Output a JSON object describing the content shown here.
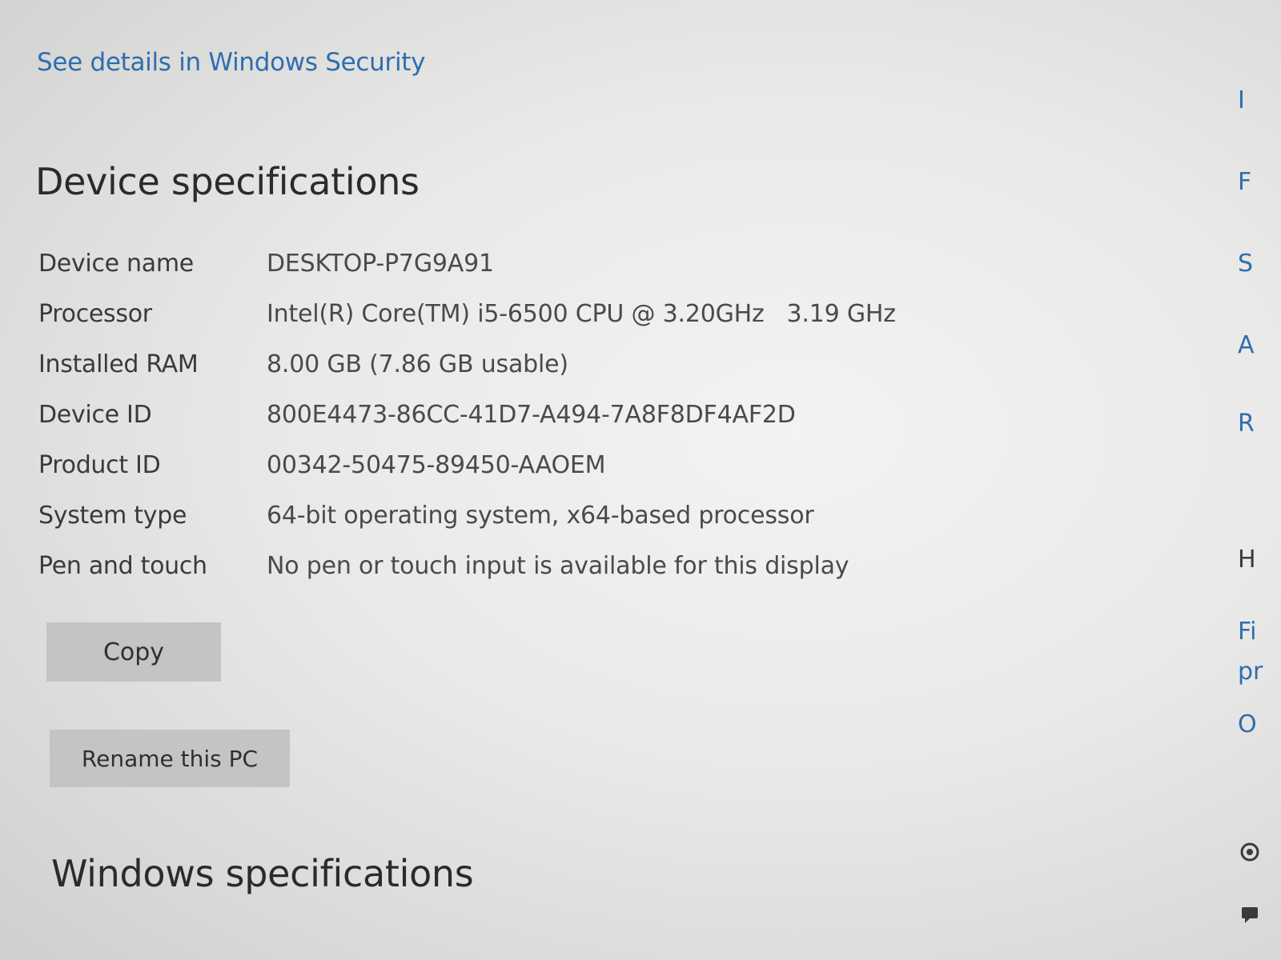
{
  "security_link": "See details in Windows Security",
  "device_section": {
    "title": "Device specifications",
    "specs": [
      {
        "label": "Device name",
        "value": "DESKTOP-P7G9A91"
      },
      {
        "label": "Processor",
        "value": "Intel(R) Core(TM) i5-6500 CPU @ 3.20GHz   3.19 GHz"
      },
      {
        "label": "Installed RAM",
        "value": "8.00 GB (7.86 GB usable)"
      },
      {
        "label": "Device ID",
        "value": "800E4473-86CC-41D7-A494-7A8F8DF4AF2D"
      },
      {
        "label": "Product ID",
        "value": "00342-50475-89450-AAOEM"
      },
      {
        "label": "System type",
        "value": "64-bit operating system, x64-based processor"
      },
      {
        "label": "Pen and touch",
        "value": "No pen or touch input is available for this display"
      }
    ],
    "copy_label": "Copy",
    "rename_label": "Rename this PC"
  },
  "windows_section": {
    "title": "Windows specifications"
  },
  "right_edge": {
    "fragments": [
      "I",
      "F",
      "S",
      "A",
      "R",
      "H",
      "Fi",
      "pr",
      "O"
    ]
  },
  "colors": {
    "link": "#2f6db0",
    "button_bg": "#c4c4c2",
    "text": "#3a3a3a"
  }
}
